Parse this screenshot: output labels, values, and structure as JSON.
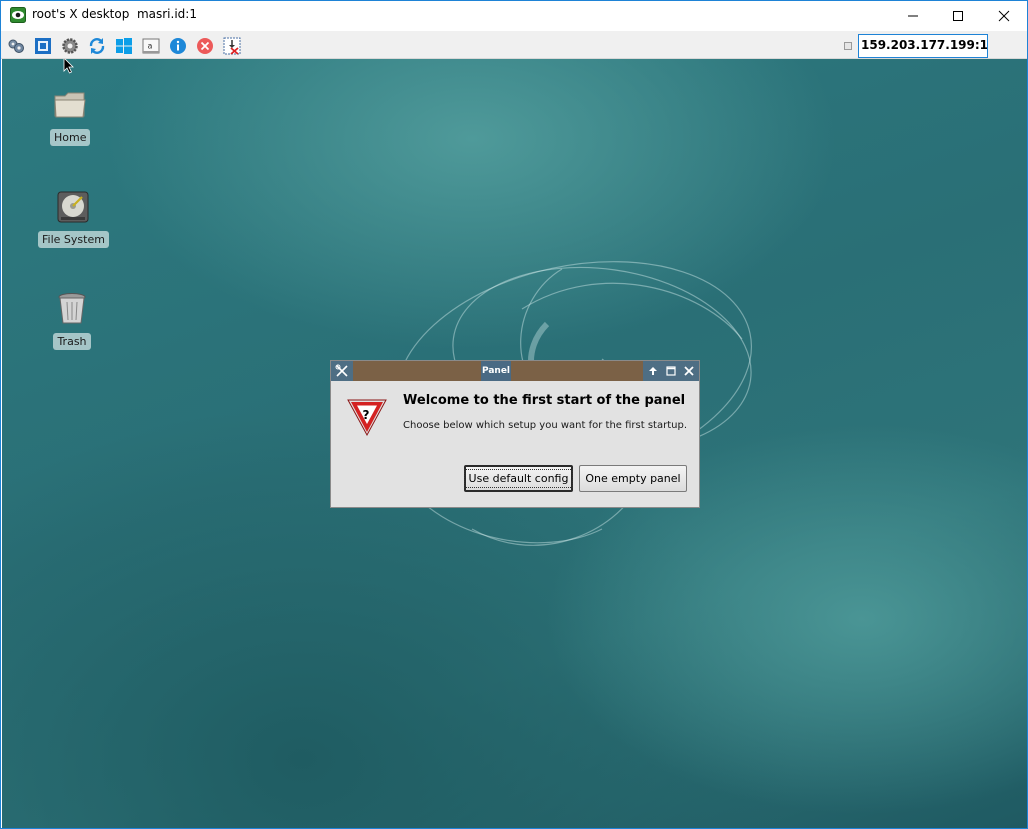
{
  "window": {
    "title": "root's X desktop  masri.id:1",
    "icon": "eye-icon",
    "controls": [
      "minimize-icon",
      "maximize-icon",
      "close-icon"
    ]
  },
  "toolbar": {
    "icons": [
      "options-icon",
      "fullscreen-icon",
      "settings-icon",
      "refresh-icon",
      "windows-key-icon",
      "keyboard-icon",
      "info-icon",
      "disconnect-icon",
      "transfer-icon"
    ],
    "address": "159.203.177.199:1"
  },
  "desktop": {
    "icons": [
      {
        "label": "Home",
        "icon": "folder-icon"
      },
      {
        "label": "File System",
        "icon": "hard-drive-icon"
      },
      {
        "label": "Trash",
        "icon": "trash-icon"
      }
    ]
  },
  "dialog": {
    "title": "Panel",
    "heading": "Welcome to the first start of the panel",
    "message": "Choose below which setup you want for the first startup.",
    "buttons": {
      "default": "Use default config",
      "empty": "One empty panel"
    }
  }
}
